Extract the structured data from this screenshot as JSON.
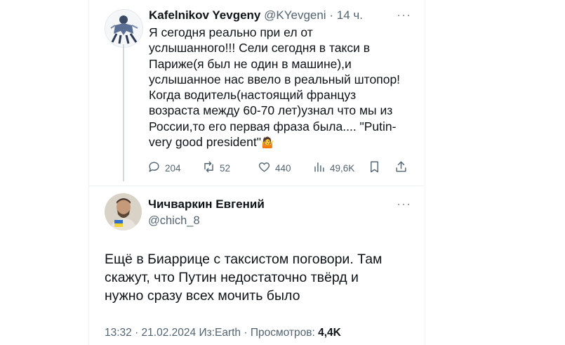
{
  "tweet1": {
    "author_name": "Kafelnikov Yevgeny",
    "handle": "@KYevgeni",
    "separator": "·",
    "time": "14 ч.",
    "lines": [
      "Я сегодня реально при    ел от",
      "услышанного!!! Сели сегодня в такси в",
      "Париже(я был не один в машине),и",
      "услышанное нас ввело в реальный штопор!",
      "Когда водитель(настоящий француз",
      "возраста между 60-70 лет)узнал что мы из",
      "России,то его первая фраза была.... \"Putin-",
      "very good president\""
    ],
    "emoji": "🤷",
    "actions": {
      "replies": "204",
      "retweets": "52",
      "likes": "440",
      "views": "49,6K"
    }
  },
  "tweet2": {
    "author_name": "Чичваркин Евгений",
    "handle": "@chich_8",
    "lines": [
      "Ещё в Биаррице с таксистом поговори. Там",
      "скажут, что Путин недостаточно твёрд и",
      "нужно сразу всех мочить было"
    ],
    "meta_prefix": "13:32 · 21.02.2024 Из:Earth · Просмотров: ",
    "views": "4,4K"
  },
  "icons": [
    "reply-icon",
    "retweet-icon",
    "like-icon",
    "views-icon",
    "bookmark-icon",
    "share-icon",
    "more-icon"
  ],
  "colors": {
    "text": "#0f1419",
    "muted": "#536471",
    "line": "#cfd9de",
    "flag_blue": "#2f6fd1",
    "flag_yellow": "#f2d22e"
  }
}
